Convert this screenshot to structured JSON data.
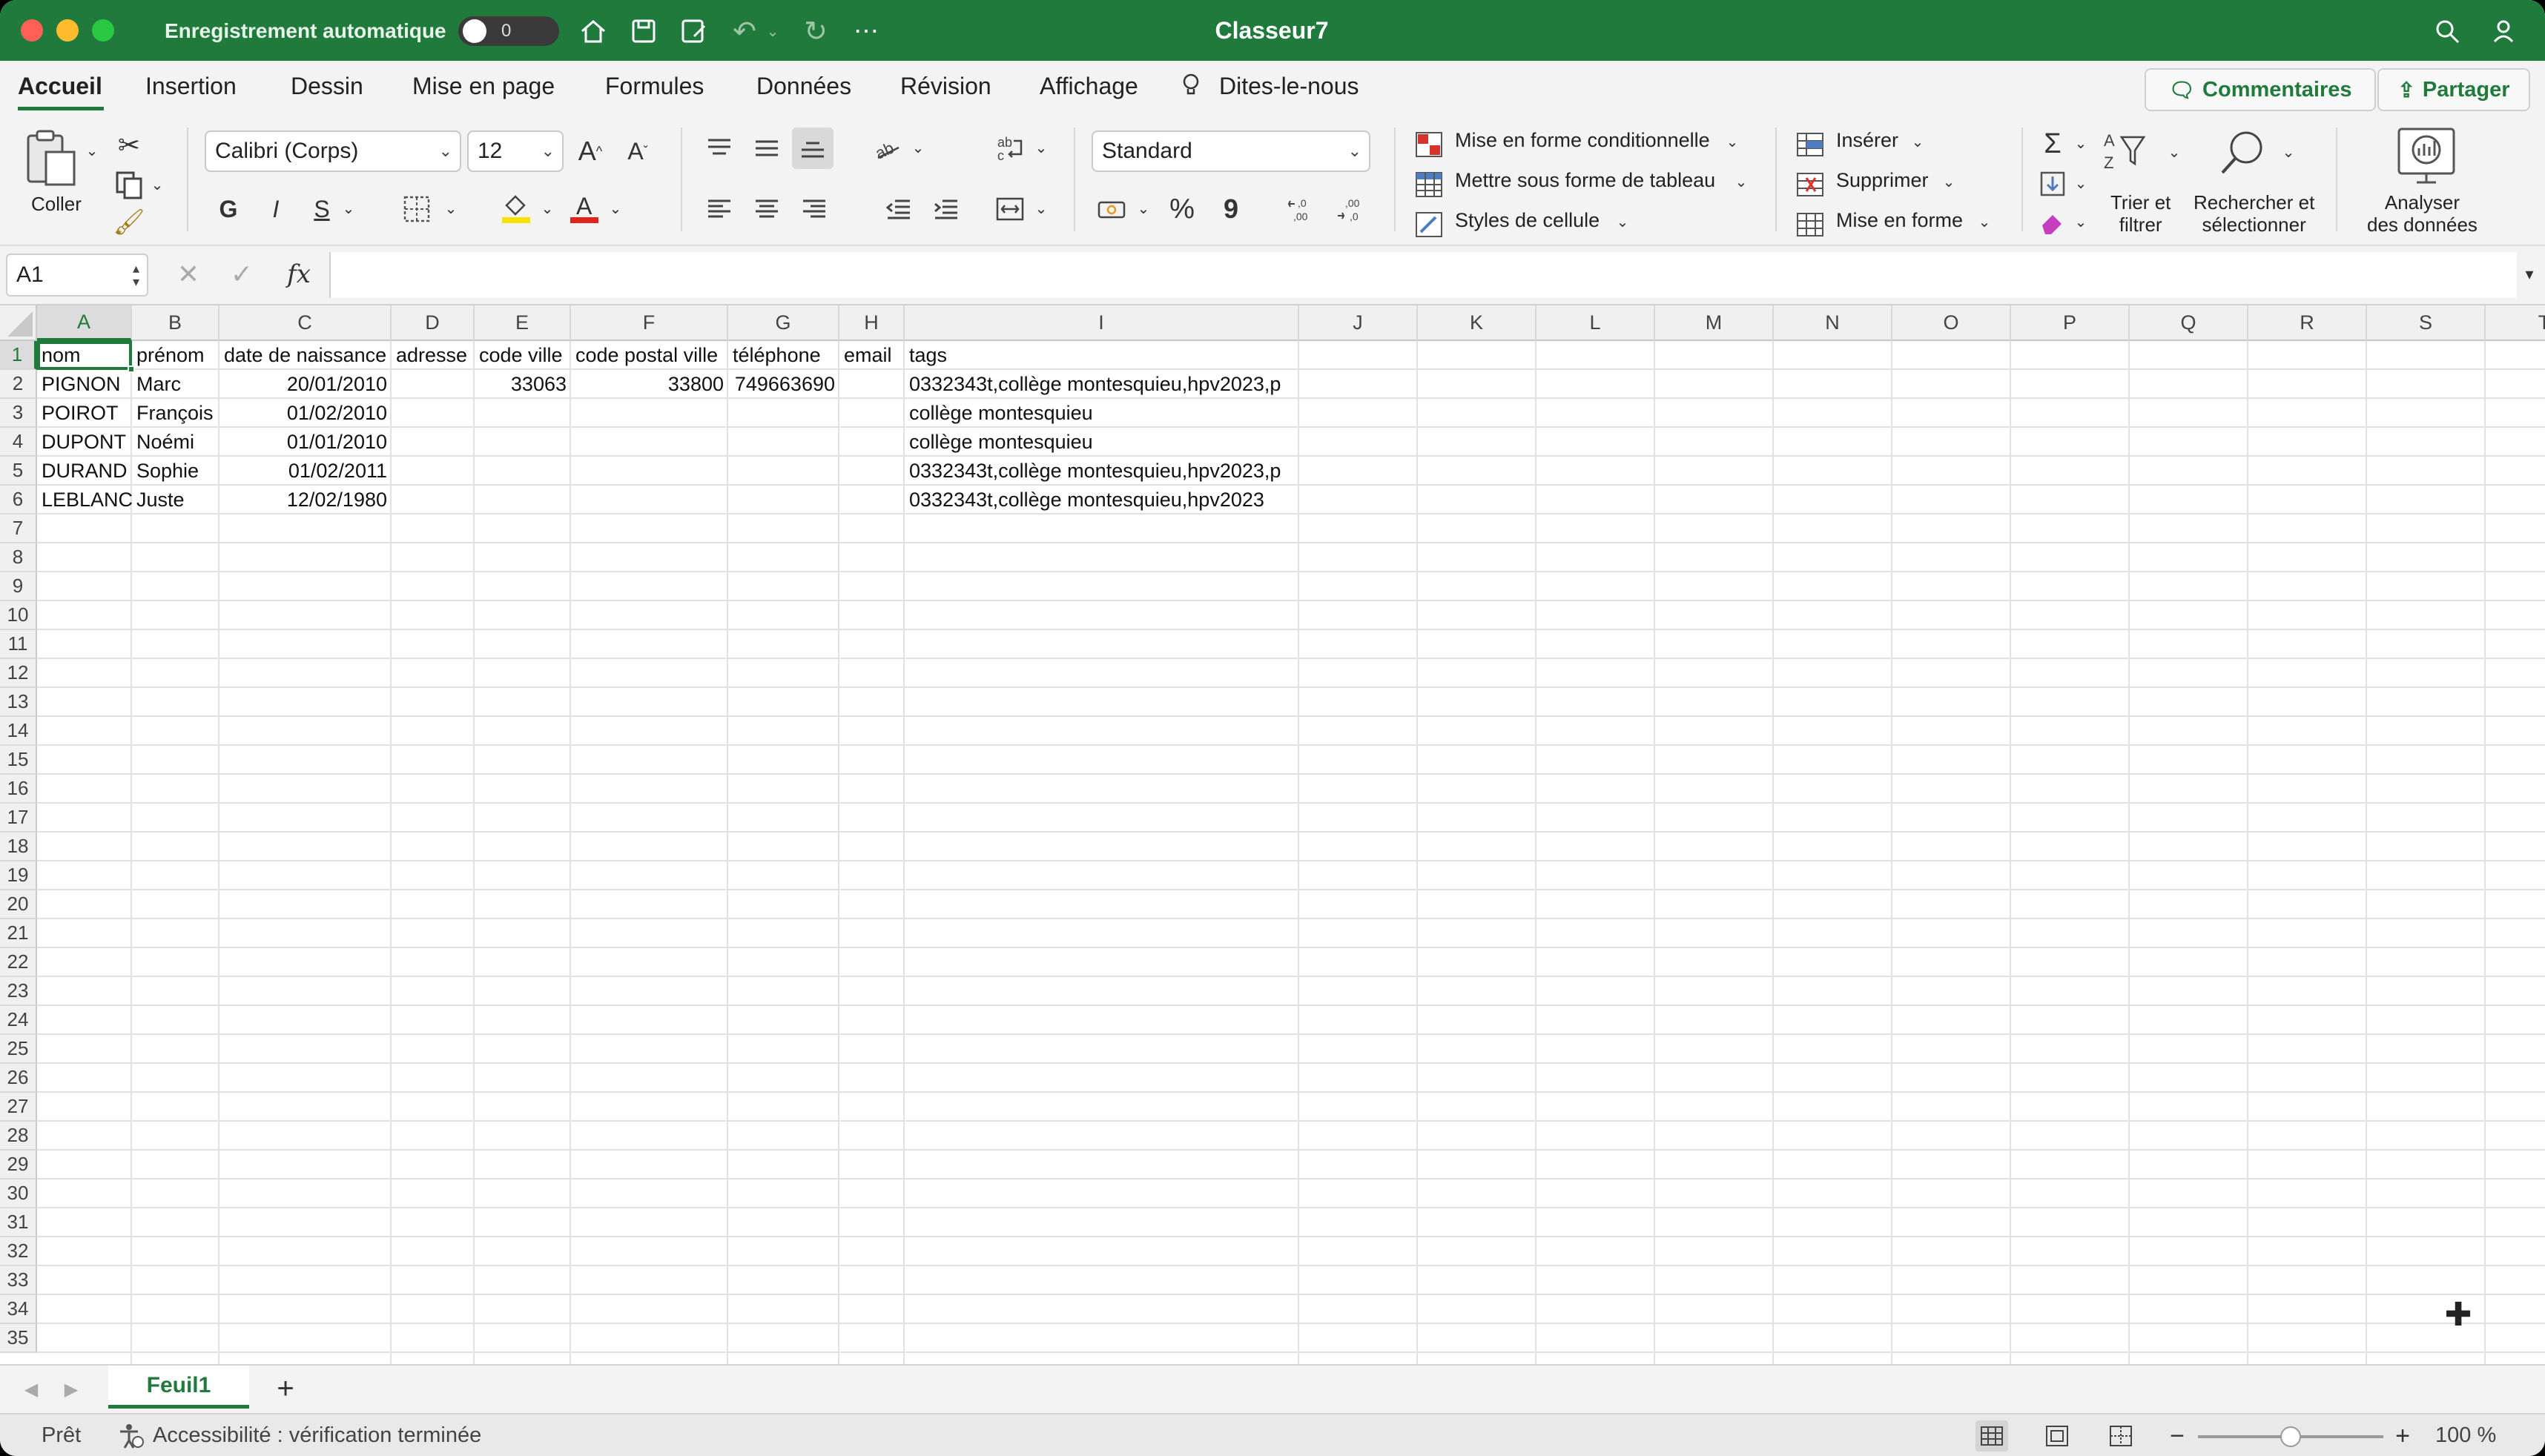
{
  "titlebar": {
    "autosave_label": "Enregistrement automatique",
    "autosave_state": "0",
    "title": "Classeur7",
    "colors": {
      "bar": "#1f7a3c",
      "close": "#fe5f57",
      "minimize": "#febc2e",
      "zoom": "#28c840"
    }
  },
  "tabs": [
    "Accueil",
    "Insertion",
    "Dessin",
    "Mise en page",
    "Formules",
    "Données",
    "Révision",
    "Affichage",
    "Dites-le-nous"
  ],
  "active_tab": "Accueil",
  "actions": {
    "comments": "Commentaires",
    "share": "Partager"
  },
  "ribbon": {
    "paste_label": "Coller",
    "font_name": "Calibri (Corps)",
    "font_size": "12",
    "bold": "G",
    "italic": "I",
    "underline": "S",
    "number_format": "Standard",
    "percent": "%",
    "thousands": "9",
    "cond_format": "Mise en forme conditionnelle",
    "format_table": "Mettre sous forme de tableau",
    "cell_styles": "Styles de cellule",
    "insert": "Insérer",
    "delete": "Supprimer",
    "format": "Mise en forme",
    "sort_filter_1": "Trier et",
    "sort_filter_2": "filtrer",
    "find_1": "Rechercher et",
    "find_2": "sélectionner",
    "analyze_1": "Analyser",
    "analyze_2": "des données"
  },
  "formula_bar": {
    "name_box": "A1",
    "fx": "fx",
    "formula": ""
  },
  "columns": [
    "A",
    "B",
    "C",
    "D",
    "E",
    "F",
    "G",
    "H",
    "I",
    "J",
    "K",
    "L",
    "M",
    "N",
    "O",
    "P",
    "Q",
    "R",
    "S",
    "T"
  ],
  "row_numbers": [
    "1",
    "2",
    "3",
    "4",
    "5",
    "6",
    "7",
    "8",
    "9",
    "10",
    "11",
    "12",
    "13",
    "14",
    "15",
    "16",
    "17",
    "18",
    "19",
    "20",
    "21",
    "22",
    "23",
    "24",
    "25",
    "26",
    "27",
    "28",
    "29",
    "30",
    "31",
    "32",
    "33",
    "34",
    "35"
  ],
  "rows": [
    [
      "nom",
      "prénom",
      "date de naissance",
      "adresse",
      "code ville",
      "code postal ville",
      "téléphone",
      "email",
      "tags"
    ],
    [
      "PIGNON",
      "Marc",
      "20/01/2010",
      "",
      "33063",
      "33800",
      "749663690",
      "",
      "0332343t,collège montesquieu,hpv2023,p"
    ],
    [
      "POIROT",
      "François",
      "01/02/2010",
      "",
      "",
      "",
      "",
      "",
      "collège montesquieu"
    ],
    [
      "DUPONT",
      "Noémi",
      "01/01/2010",
      "",
      "",
      "",
      "",
      "",
      "collège montesquieu"
    ],
    [
      "DURAND",
      "Sophie",
      "01/02/2011",
      "",
      "",
      "",
      "",
      "",
      "0332343t,collège montesquieu,hpv2023,p"
    ],
    [
      "LEBLANC",
      "Juste",
      "12/02/1980",
      "",
      "",
      "",
      "",
      "",
      "0332343t,collège montesquieu,hpv2023"
    ]
  ],
  "sheets": [
    "Feuil1"
  ],
  "add_sheet": "+",
  "status": {
    "ready": "Prêt",
    "accessibility": "Accessibilité : vérification terminée",
    "zoom": "100 %",
    "zoom_minus": "−",
    "zoom_plus": "+"
  }
}
